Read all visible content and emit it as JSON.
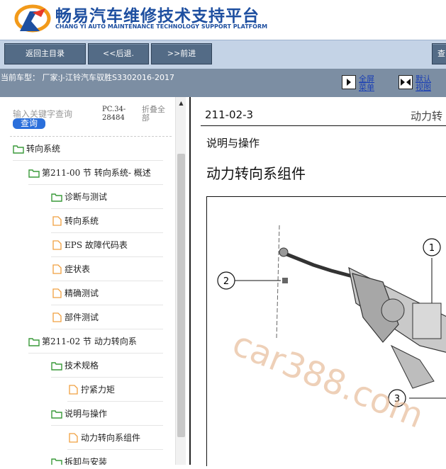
{
  "header": {
    "title": "畅易汽车维修技术支持平台",
    "subtitle": "CHANG YI AUTO MAINTENANCE TECHNOLOGY SUPPORT PLATFORM"
  },
  "toolbar": {
    "home": "返回主目录",
    "back": "<<后退.",
    "forward": ">>前进",
    "right_cut": "查"
  },
  "infobar": {
    "vehicle": "当前车型： 厂家:J-江铃汽车驭胜S3302016-2017",
    "fullscreen_line1": "全屏",
    "fullscreen_line2": "菜单",
    "default_line1": "默认",
    "default_line2": "视图"
  },
  "sidebar": {
    "search_placeholder": "输入关键字查询",
    "search_button": "查询",
    "pc_code": "PC.34-28484",
    "collapse_all": "折叠全部",
    "tree": [
      {
        "label": "转向系统",
        "icon": "folder-icon",
        "level": 0
      },
      {
        "label": "第211-00 节 转向系统- 概述",
        "icon": "folder-icon",
        "level": 1
      },
      {
        "label": "诊断与测试",
        "icon": "folder-icon",
        "level": 2
      },
      {
        "label": "转向系统",
        "icon": "document-icon",
        "level": 2
      },
      {
        "label": "EPS 故障代码表",
        "icon": "document-icon",
        "level": 2
      },
      {
        "label": "症状表",
        "icon": "document-icon",
        "level": 2
      },
      {
        "label": "精确测试",
        "icon": "document-icon",
        "level": 2
      },
      {
        "label": "部件测试",
        "icon": "document-icon",
        "level": 2
      },
      {
        "label": "第211-02 节 动力转向系",
        "icon": "folder-icon",
        "level": 1
      },
      {
        "label": "技术规格",
        "icon": "folder-icon",
        "level": 2
      },
      {
        "label": "拧紧力矩",
        "icon": "document-icon",
        "level": 3
      },
      {
        "label": "说明与操作",
        "icon": "folder-icon",
        "level": 2
      },
      {
        "label": "动力转向系组件",
        "icon": "document-icon",
        "level": 3
      },
      {
        "label": "拆卸与安装",
        "icon": "folder-icon",
        "level": 2
      }
    ]
  },
  "document": {
    "code": "211-02-3",
    "code_right": "动力转",
    "section": "说明与操作",
    "heading": "动力转向系组件",
    "callouts": [
      "1",
      "2",
      "3"
    ],
    "watermark": "car388.com"
  },
  "colors": {
    "brand_blue": "#1e4fa0",
    "toolbar_bg": "#c4d3e6",
    "button_bg": "#536b86",
    "infobar_bg": "#7c8ea3",
    "folder_green": "#3a9a3a",
    "document_orange": "#f0a040"
  }
}
